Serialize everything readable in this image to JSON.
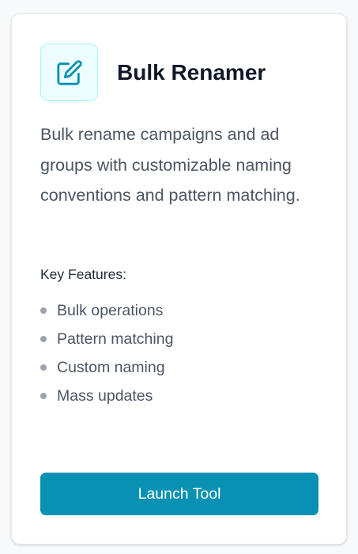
{
  "tool": {
    "title": "Bulk Renamer",
    "icon": "edit-icon",
    "description": "Bulk rename campaigns and ad groups with customizable naming conventions and pattern matching.",
    "features_heading": "Key Features:",
    "features": [
      "Bulk operations",
      "Pattern matching",
      "Custom naming",
      "Mass updates"
    ],
    "button_label": "Launch Tool"
  },
  "colors": {
    "accent": "#0891b2",
    "icon_bg": "#ecfeff",
    "title": "#111827",
    "text": "#4b5563"
  }
}
